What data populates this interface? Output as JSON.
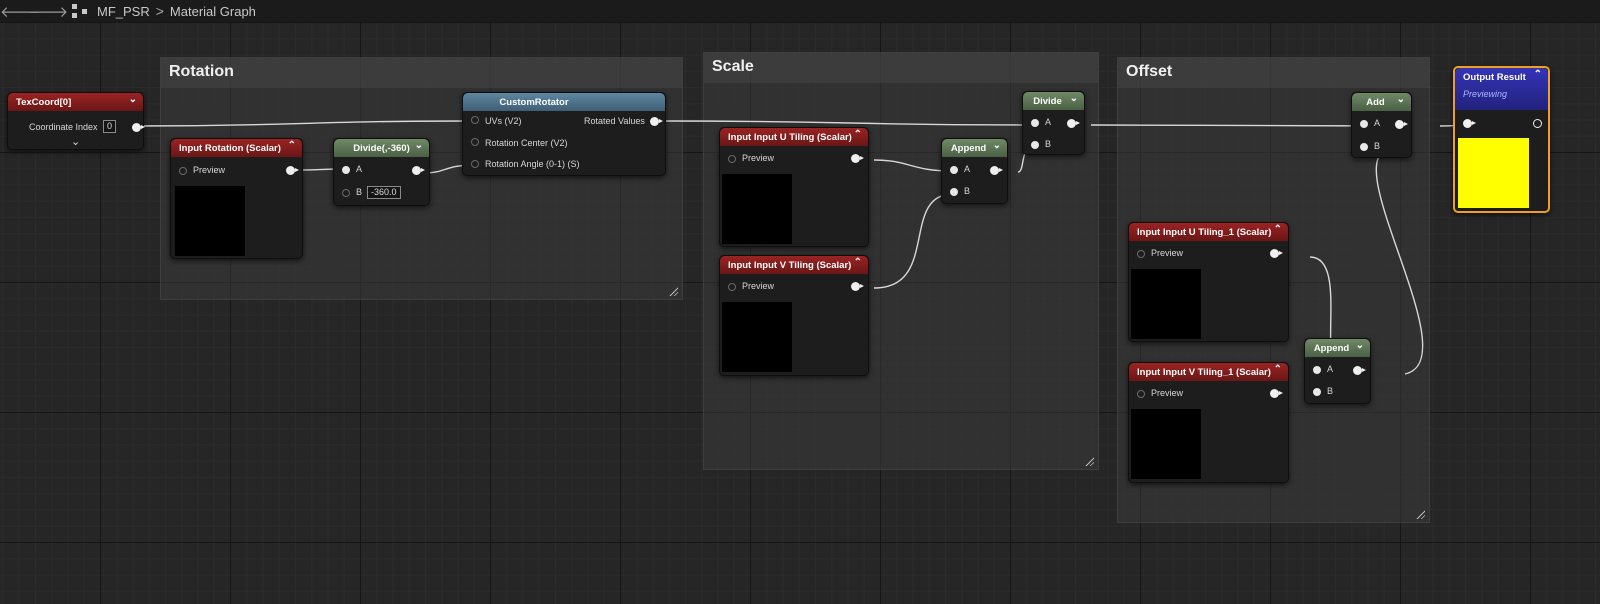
{
  "topbar": {
    "back_icon": "arrow-left-icon",
    "forward_icon": "arrow-right-icon",
    "back": "🡐",
    "forward": "🡒",
    "asset": "MF_PSR",
    "separator": ">",
    "graph": "Material Graph"
  },
  "comments": {
    "rotation": "Rotation",
    "scale": "Scale",
    "offset": "Offset"
  },
  "nodes": {
    "texcoord": {
      "title": "TexCoord[0]",
      "coordinate_index_label": "Coordinate Index",
      "coordinate_index_value": "0"
    },
    "input_rotation": {
      "title": "Input Rotation (Scalar)",
      "preview": "Preview"
    },
    "divide_rot": {
      "title": "Divide(,-360)",
      "a": "A",
      "b": "B",
      "b_value": "-360.0"
    },
    "custom_rotator": {
      "title": "CustomRotator",
      "uvs": "UVs (V2)",
      "center": "Rotation Center (V2)",
      "angle": "Rotation Angle (0-1) (S)",
      "output": "Rotated Values"
    },
    "u_tiling": {
      "title": "Input Input U Tiling (Scalar)",
      "preview": "Preview"
    },
    "v_tiling": {
      "title": "Input Input V Tiling (Scalar)",
      "preview": "Preview"
    },
    "append_scale": {
      "title": "Append",
      "a": "A",
      "b": "B"
    },
    "divide_scale": {
      "title": "Divide",
      "a": "A",
      "b": "B"
    },
    "u_tiling_1": {
      "title": "Input Input U Tiling_1 (Scalar)",
      "preview": "Preview"
    },
    "v_tiling_1": {
      "title": "Input Input V Tiling_1 (Scalar)",
      "preview": "Preview"
    },
    "append_offset": {
      "title": "Append",
      "a": "A",
      "b": "B"
    },
    "add": {
      "title": "Add",
      "a": "A",
      "b": "B"
    },
    "output_result": {
      "title": "Output Result",
      "subtitle": "Previewing",
      "preview_color": "#ffff00"
    }
  },
  "colors": {
    "accent_selected": "#f0a020",
    "node_red": "#9b2323",
    "node_green": "#6f8a66",
    "node_blue": "#5e86a0",
    "node_output": "#3434b8"
  }
}
